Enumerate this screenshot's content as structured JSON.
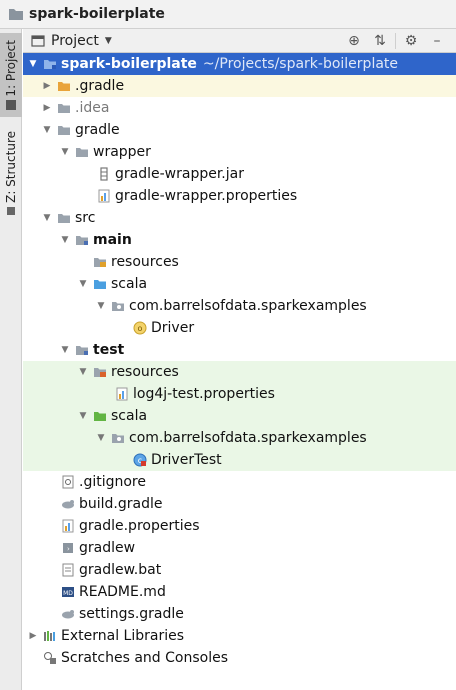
{
  "window": {
    "title": "spark-boilerplate"
  },
  "sidebar": {
    "tabs": [
      {
        "label": "1: Project"
      },
      {
        "label": "Z: Structure"
      }
    ]
  },
  "panel": {
    "view_label": "Project"
  },
  "tree": {
    "root": {
      "label": "spark-boilerplate",
      "path": "~/Projects/spark-boilerplate"
    },
    "gradle_dir": ".gradle",
    "idea_dir": ".idea",
    "gradle_folder": "gradle",
    "wrapper": "wrapper",
    "wrapper_jar": "gradle-wrapper.jar",
    "wrapper_props": "gradle-wrapper.properties",
    "src": "src",
    "main": "main",
    "main_resources": "resources",
    "main_scala": "scala",
    "main_pkg": "com.barrelsofdata.sparkexamples",
    "driver": "Driver",
    "test": "test",
    "test_resources": "resources",
    "log4j": "log4j-test.properties",
    "test_scala": "scala",
    "test_pkg": "com.barrelsofdata.sparkexamples",
    "driver_test": "DriverTest",
    "gitignore": ".gitignore",
    "build_gradle": "build.gradle",
    "gradle_props": "gradle.properties",
    "gradlew": "gradlew",
    "gradlew_bat": "gradlew.bat",
    "readme": "README.md",
    "settings_gradle": "settings.gradle",
    "external_libs": "External Libraries",
    "scratches": "Scratches and Consoles"
  },
  "colors": {
    "selection": "#2f65ca",
    "test_bg": "#eaf7e6",
    "folder": "#9aa3ad",
    "source_folder": "#4a9fe0",
    "test_folder": "#62b543"
  }
}
